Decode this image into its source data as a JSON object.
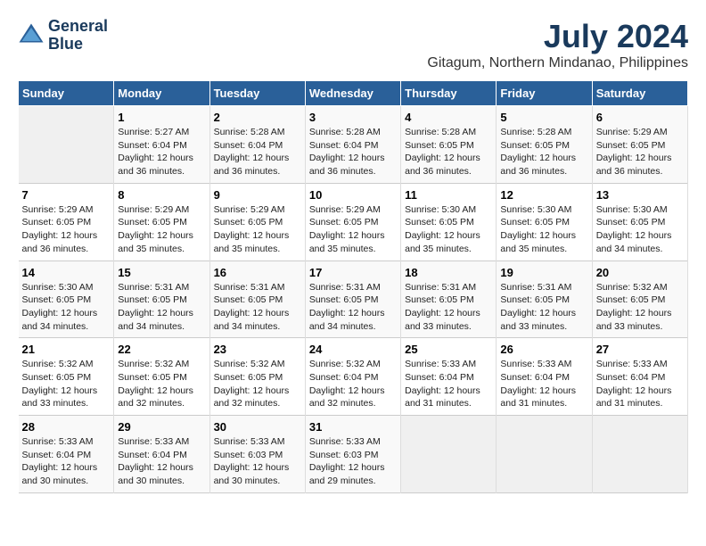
{
  "logo": {
    "line1": "General",
    "line2": "Blue"
  },
  "title": "July 2024",
  "subtitle": "Gitagum, Northern Mindanao, Philippines",
  "headers": [
    "Sunday",
    "Monday",
    "Tuesday",
    "Wednesday",
    "Thursday",
    "Friday",
    "Saturday"
  ],
  "weeks": [
    [
      {
        "day": "",
        "sunrise": "",
        "sunset": "",
        "daylight": ""
      },
      {
        "day": "1",
        "sunrise": "Sunrise: 5:27 AM",
        "sunset": "Sunset: 6:04 PM",
        "daylight": "Daylight: 12 hours and 36 minutes."
      },
      {
        "day": "2",
        "sunrise": "Sunrise: 5:28 AM",
        "sunset": "Sunset: 6:04 PM",
        "daylight": "Daylight: 12 hours and 36 minutes."
      },
      {
        "day": "3",
        "sunrise": "Sunrise: 5:28 AM",
        "sunset": "Sunset: 6:04 PM",
        "daylight": "Daylight: 12 hours and 36 minutes."
      },
      {
        "day": "4",
        "sunrise": "Sunrise: 5:28 AM",
        "sunset": "Sunset: 6:05 PM",
        "daylight": "Daylight: 12 hours and 36 minutes."
      },
      {
        "day": "5",
        "sunrise": "Sunrise: 5:28 AM",
        "sunset": "Sunset: 6:05 PM",
        "daylight": "Daylight: 12 hours and 36 minutes."
      },
      {
        "day": "6",
        "sunrise": "Sunrise: 5:29 AM",
        "sunset": "Sunset: 6:05 PM",
        "daylight": "Daylight: 12 hours and 36 minutes."
      }
    ],
    [
      {
        "day": "7",
        "sunrise": "Sunrise: 5:29 AM",
        "sunset": "Sunset: 6:05 PM",
        "daylight": "Daylight: 12 hours and 36 minutes."
      },
      {
        "day": "8",
        "sunrise": "Sunrise: 5:29 AM",
        "sunset": "Sunset: 6:05 PM",
        "daylight": "Daylight: 12 hours and 35 minutes."
      },
      {
        "day": "9",
        "sunrise": "Sunrise: 5:29 AM",
        "sunset": "Sunset: 6:05 PM",
        "daylight": "Daylight: 12 hours and 35 minutes."
      },
      {
        "day": "10",
        "sunrise": "Sunrise: 5:29 AM",
        "sunset": "Sunset: 6:05 PM",
        "daylight": "Daylight: 12 hours and 35 minutes."
      },
      {
        "day": "11",
        "sunrise": "Sunrise: 5:30 AM",
        "sunset": "Sunset: 6:05 PM",
        "daylight": "Daylight: 12 hours and 35 minutes."
      },
      {
        "day": "12",
        "sunrise": "Sunrise: 5:30 AM",
        "sunset": "Sunset: 6:05 PM",
        "daylight": "Daylight: 12 hours and 35 minutes."
      },
      {
        "day": "13",
        "sunrise": "Sunrise: 5:30 AM",
        "sunset": "Sunset: 6:05 PM",
        "daylight": "Daylight: 12 hours and 34 minutes."
      }
    ],
    [
      {
        "day": "14",
        "sunrise": "Sunrise: 5:30 AM",
        "sunset": "Sunset: 6:05 PM",
        "daylight": "Daylight: 12 hours and 34 minutes."
      },
      {
        "day": "15",
        "sunrise": "Sunrise: 5:31 AM",
        "sunset": "Sunset: 6:05 PM",
        "daylight": "Daylight: 12 hours and 34 minutes."
      },
      {
        "day": "16",
        "sunrise": "Sunrise: 5:31 AM",
        "sunset": "Sunset: 6:05 PM",
        "daylight": "Daylight: 12 hours and 34 minutes."
      },
      {
        "day": "17",
        "sunrise": "Sunrise: 5:31 AM",
        "sunset": "Sunset: 6:05 PM",
        "daylight": "Daylight: 12 hours and 34 minutes."
      },
      {
        "day": "18",
        "sunrise": "Sunrise: 5:31 AM",
        "sunset": "Sunset: 6:05 PM",
        "daylight": "Daylight: 12 hours and 33 minutes."
      },
      {
        "day": "19",
        "sunrise": "Sunrise: 5:31 AM",
        "sunset": "Sunset: 6:05 PM",
        "daylight": "Daylight: 12 hours and 33 minutes."
      },
      {
        "day": "20",
        "sunrise": "Sunrise: 5:32 AM",
        "sunset": "Sunset: 6:05 PM",
        "daylight": "Daylight: 12 hours and 33 minutes."
      }
    ],
    [
      {
        "day": "21",
        "sunrise": "Sunrise: 5:32 AM",
        "sunset": "Sunset: 6:05 PM",
        "daylight": "Daylight: 12 hours and 33 minutes."
      },
      {
        "day": "22",
        "sunrise": "Sunrise: 5:32 AM",
        "sunset": "Sunset: 6:05 PM",
        "daylight": "Daylight: 12 hours and 32 minutes."
      },
      {
        "day": "23",
        "sunrise": "Sunrise: 5:32 AM",
        "sunset": "Sunset: 6:05 PM",
        "daylight": "Daylight: 12 hours and 32 minutes."
      },
      {
        "day": "24",
        "sunrise": "Sunrise: 5:32 AM",
        "sunset": "Sunset: 6:04 PM",
        "daylight": "Daylight: 12 hours and 32 minutes."
      },
      {
        "day": "25",
        "sunrise": "Sunrise: 5:33 AM",
        "sunset": "Sunset: 6:04 PM",
        "daylight": "Daylight: 12 hours and 31 minutes."
      },
      {
        "day": "26",
        "sunrise": "Sunrise: 5:33 AM",
        "sunset": "Sunset: 6:04 PM",
        "daylight": "Daylight: 12 hours and 31 minutes."
      },
      {
        "day": "27",
        "sunrise": "Sunrise: 5:33 AM",
        "sunset": "Sunset: 6:04 PM",
        "daylight": "Daylight: 12 hours and 31 minutes."
      }
    ],
    [
      {
        "day": "28",
        "sunrise": "Sunrise: 5:33 AM",
        "sunset": "Sunset: 6:04 PM",
        "daylight": "Daylight: 12 hours and 30 minutes."
      },
      {
        "day": "29",
        "sunrise": "Sunrise: 5:33 AM",
        "sunset": "Sunset: 6:04 PM",
        "daylight": "Daylight: 12 hours and 30 minutes."
      },
      {
        "day": "30",
        "sunrise": "Sunrise: 5:33 AM",
        "sunset": "Sunset: 6:03 PM",
        "daylight": "Daylight: 12 hours and 30 minutes."
      },
      {
        "day": "31",
        "sunrise": "Sunrise: 5:33 AM",
        "sunset": "Sunset: 6:03 PM",
        "daylight": "Daylight: 12 hours and 29 minutes."
      },
      {
        "day": "",
        "sunrise": "",
        "sunset": "",
        "daylight": ""
      },
      {
        "day": "",
        "sunrise": "",
        "sunset": "",
        "daylight": ""
      },
      {
        "day": "",
        "sunrise": "",
        "sunset": "",
        "daylight": ""
      }
    ]
  ]
}
